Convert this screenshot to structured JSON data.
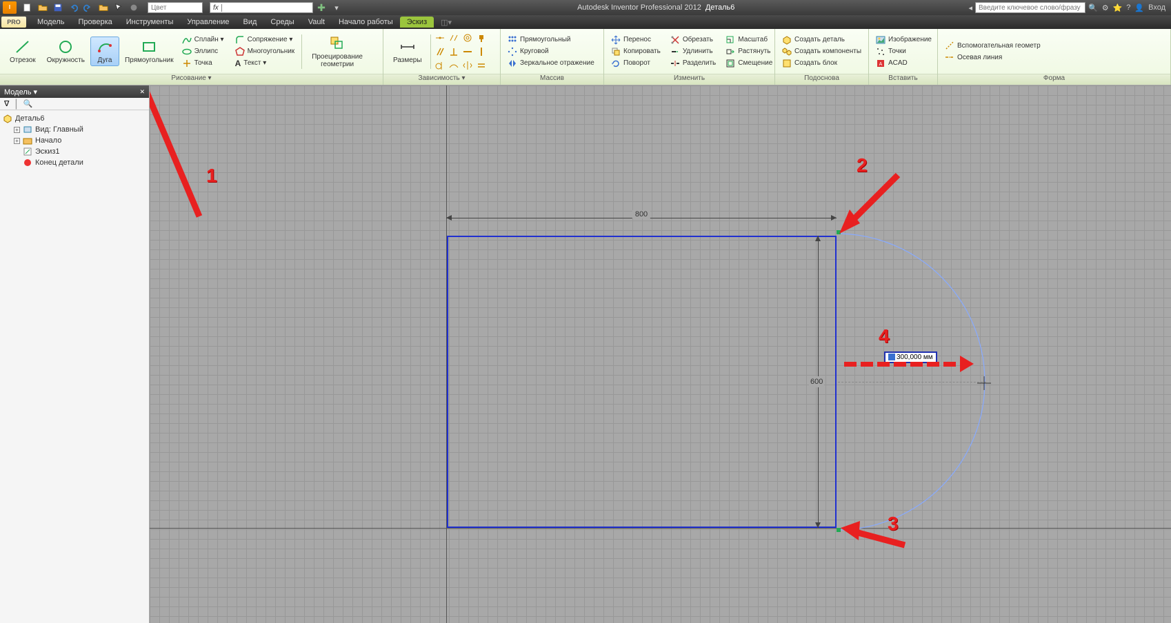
{
  "titlebar": {
    "app_name": "Autodesk Inventor Professional 2012",
    "doc_name": "Деталь6",
    "color_placeholder": "Цвет",
    "fx_label": "fx",
    "search_placeholder": "Введите ключевое слово/фразу",
    "login_label": "Вход"
  },
  "menubar": {
    "pro_badge": "PRO",
    "items": [
      "Модель",
      "Проверка",
      "Инструменты",
      "Управление",
      "Вид",
      "Среды",
      "Vault",
      "Начало работы",
      "Эскиз"
    ],
    "active_index": 8
  },
  "ribbon": {
    "panels": [
      {
        "title": "Рисование ▾",
        "big": [
          {
            "label": "Отрезок"
          },
          {
            "label": "Окружность"
          },
          {
            "label": "Дуга",
            "active": true
          },
          {
            "label": "Прямоугольник"
          }
        ],
        "cols": [
          [
            {
              "label": "Сплайн ▾"
            },
            {
              "label": "Эллипс"
            },
            {
              "label": "Точка"
            }
          ],
          [
            {
              "label": "Сопряжение ▾"
            },
            {
              "label": "Многоугольник"
            },
            {
              "label": "Текст ▾"
            }
          ]
        ],
        "extra_big": {
          "label": "Проецирование\nгеометрии"
        }
      },
      {
        "title": "Зависимость ▾",
        "big": [
          {
            "label": "Размеры"
          }
        ]
      },
      {
        "title": "Массив",
        "small": [
          {
            "label": "Прямоугольный"
          },
          {
            "label": "Круговой"
          },
          {
            "label": "Зеркальное отражение"
          }
        ]
      },
      {
        "title": "Изменить",
        "cols": [
          [
            {
              "label": "Перенос"
            },
            {
              "label": "Копировать"
            },
            {
              "label": "Поворот"
            }
          ],
          [
            {
              "label": "Обрезать"
            },
            {
              "label": "Удлинить"
            },
            {
              "label": "Разделить"
            }
          ],
          [
            {
              "label": "Масштаб"
            },
            {
              "label": "Растянуть"
            },
            {
              "label": "Смещение"
            }
          ]
        ]
      },
      {
        "title": "Подоснова",
        "small": [
          {
            "label": "Создать деталь"
          },
          {
            "label": "Создать компоненты"
          },
          {
            "label": "Создать блок"
          }
        ]
      },
      {
        "title": "Вставить",
        "small": [
          {
            "label": "Изображение"
          },
          {
            "label": "Точки"
          },
          {
            "label": "ACAD"
          }
        ]
      },
      {
        "title": "Форма",
        "small": [
          {
            "label": "Вспомогательная геометр"
          },
          {
            "label": "Осевая линия"
          }
        ]
      }
    ]
  },
  "sidebar": {
    "header": "Модель ▾",
    "filter_icon": "filter",
    "search_icon": "binoculars",
    "tree": [
      {
        "icon": "part",
        "label": "Деталь6"
      },
      {
        "icon": "view",
        "label": "Вид: Главный",
        "indent": 1,
        "expand": "+"
      },
      {
        "icon": "folder",
        "label": "Начало",
        "indent": 1,
        "expand": "+"
      },
      {
        "icon": "sketch",
        "label": "Эскиз1",
        "indent": 1
      },
      {
        "icon": "end",
        "label": "Конец детали",
        "indent": 1
      }
    ]
  },
  "canvas": {
    "dim_h": "800",
    "dim_v": "600",
    "input_value": "300,000 мм"
  },
  "annotations": {
    "num1": "1",
    "num2": "2",
    "num3": "3",
    "num4": "4"
  }
}
